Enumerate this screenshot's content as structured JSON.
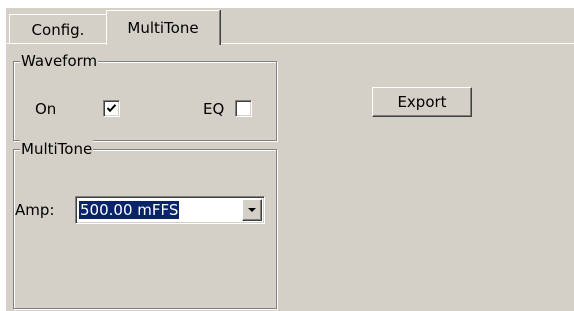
{
  "tabs": [
    {
      "label": "Config.",
      "active": false
    },
    {
      "label": "MultiTone",
      "active": true
    }
  ],
  "waveform_group": {
    "title": "Waveform",
    "on_label": "On",
    "on_checked": true,
    "eq_label": "EQ",
    "eq_checked": false
  },
  "multitone_group": {
    "title": "MultiTone",
    "amp_label": "Amp:",
    "amp_value": "500.00 mFFS"
  },
  "export_button": {
    "label": "Export"
  },
  "colors": {
    "panel_bg": "#d4d0c8",
    "selection_bg": "#0a246a",
    "selection_text": "#ffffff"
  },
  "icons": {
    "check": "check-mark-icon",
    "dropdown": "chevron-down-icon"
  }
}
